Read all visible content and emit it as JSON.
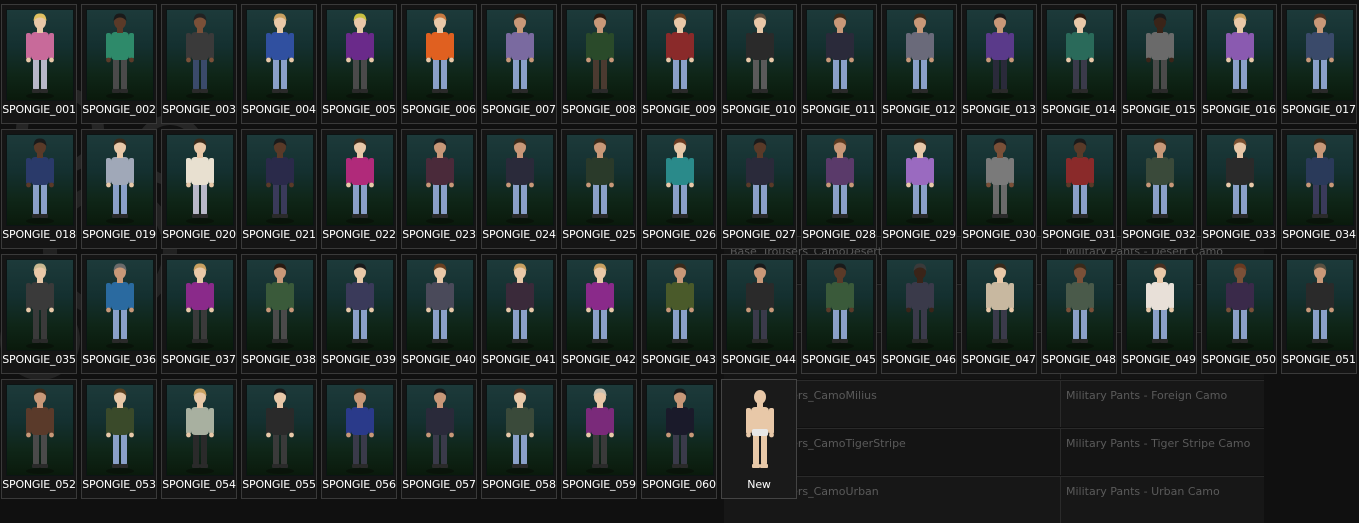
{
  "background_table": {
    "rows": [
      {
        "name": "Base_Trousers_CamoDesert",
        "display": "Military Pants - Desert Camo"
      },
      {
        "name": "",
        "display": ""
      },
      {
        "name": "",
        "display": ""
      },
      {
        "name": "Base_Trousers_CamoMilius",
        "display": "Military Pants - Foreign Camo"
      },
      {
        "name": "Base_Trousers_CamoTigerStripe",
        "display": "Military Pants - Tiger Stripe Camo"
      },
      {
        "name": "Base_Trousers_CamoUrban",
        "display": "Military Pants - Urban Camo"
      }
    ]
  },
  "presets": [
    {
      "label": "SPONGIE_001",
      "top": "#c86a9a",
      "legs": "#b8b8c8",
      "hair": "#e0c060",
      "skin": "#e8c8a8"
    },
    {
      "label": "SPONGIE_002",
      "top": "#2e8a6a",
      "legs": "#4a4a4a",
      "hair": "#1a1a1a",
      "skin": "#5a3a28"
    },
    {
      "label": "SPONGIE_003",
      "top": "#3a3a3a",
      "legs": "#3a4a6a",
      "hair": "#222222",
      "skin": "#7a5038"
    },
    {
      "label": "SPONGIE_004",
      "top": "#3050a0",
      "legs": "#8aa0c8",
      "hair": "#c8a060",
      "skin": "#e8c8a8"
    },
    {
      "label": "SPONGIE_005",
      "top": "#6a2a8a",
      "legs": "#4a4a4a",
      "hair": "#c8c040",
      "skin": "#e8c8a8"
    },
    {
      "label": "SPONGIE_006",
      "top": "#e06020",
      "legs": "#8aa0c8",
      "hair": "#c87a40",
      "skin": "#e8c8a8"
    },
    {
      "label": "SPONGIE_007",
      "top": "#7a6aa0",
      "legs": "#8aa0c8",
      "hair": "#3a2a1a",
      "skin": "#c89878"
    },
    {
      "label": "SPONGIE_008",
      "top": "#2a4a2a",
      "legs": "#4a3a30",
      "hair": "#2a1a10",
      "skin": "#c89878"
    },
    {
      "label": "SPONGIE_009",
      "top": "#8a2a2a",
      "legs": "#8aa0c8",
      "hair": "#6a4020",
      "skin": "#e8c8a8"
    },
    {
      "label": "SPONGIE_010",
      "top": "#2a2a2a",
      "legs": "#5a5a5a",
      "hair": "#5a4a3a",
      "skin": "#e8c8a8"
    },
    {
      "label": "SPONGIE_011",
      "top": "#2a2a3a",
      "legs": "#8aa0c8",
      "hair": "#3a2a1a",
      "skin": "#c89878"
    },
    {
      "label": "SPONGIE_012",
      "top": "#6a6a7a",
      "legs": "#8aa0c8",
      "hair": "#3a2a1a",
      "skin": "#c89878"
    },
    {
      "label": "SPONGIE_013",
      "top": "#5a3a8a",
      "legs": "#2a2a3a",
      "hair": "#1a1a1a",
      "skin": "#c89878"
    },
    {
      "label": "SPONGIE_014",
      "top": "#2a6a5a",
      "legs": "#3a3a4a",
      "hair": "#2a1a10",
      "skin": "#e8c8a8"
    },
    {
      "label": "SPONGIE_015",
      "top": "#6a6a6a",
      "legs": "#4a4a4a",
      "hair": "#1a1a1a",
      "skin": "#3a2418"
    },
    {
      "label": "SPONGIE_016",
      "top": "#8a5ab0",
      "legs": "#8aa0c8",
      "hair": "#c8a060",
      "skin": "#e8c8a8"
    },
    {
      "label": "SPONGIE_017",
      "top": "#3a4a6a",
      "legs": "#8aa0c8",
      "hair": "#4a3020",
      "skin": "#c89878"
    },
    {
      "label": "SPONGIE_018",
      "top": "#2a3a6a",
      "legs": "#8aa0c8",
      "hair": "#1a1a1a",
      "skin": "#5a3a28"
    },
    {
      "label": "SPONGIE_019",
      "top": "#a0a8b8",
      "legs": "#8aa0c8",
      "hair": "#3a2a1a",
      "skin": "#e8c8a8"
    },
    {
      "label": "SPONGIE_020",
      "top": "#e8e0d0",
      "legs": "#b8b8c8",
      "hair": "#3a2a1a",
      "skin": "#e8c8a8"
    },
    {
      "label": "SPONGIE_021",
      "top": "#2a2a4a",
      "legs": "#3a3a5a",
      "hair": "#1a1a1a",
      "skin": "#5a3a28"
    },
    {
      "label": "SPONGIE_022",
      "top": "#b02a7a",
      "legs": "#8aa0c8",
      "hair": "#3a2a1a",
      "skin": "#e8c8a8"
    },
    {
      "label": "SPONGIE_023",
      "top": "#4a2a3a",
      "legs": "#8aa0c8",
      "hair": "#1a1a1a",
      "skin": "#c89878"
    },
    {
      "label": "SPONGIE_024",
      "top": "#2a2a3a",
      "legs": "#8aa0c8",
      "hair": "#3a2a1a",
      "skin": "#c89878"
    },
    {
      "label": "SPONGIE_025",
      "top": "#2a3a2a",
      "legs": "#8aa0c8",
      "hair": "#3a2a1a",
      "skin": "#c89878"
    },
    {
      "label": "SPONGIE_026",
      "top": "#2a8a8a",
      "legs": "#8aa0c8",
      "hair": "#6a3a20",
      "skin": "#e8c8a8"
    },
    {
      "label": "SPONGIE_027",
      "top": "#2a2a3a",
      "legs": "#8aa0c8",
      "hair": "#1a1a1a",
      "skin": "#5a3a28"
    },
    {
      "label": "SPONGIE_028",
      "top": "#5a3a6a",
      "legs": "#8aa0c8",
      "hair": "#5a3a20",
      "skin": "#c89878"
    },
    {
      "label": "SPONGIE_029",
      "top": "#9a6ac0",
      "legs": "#8aa0c8",
      "hair": "#3a2a1a",
      "skin": "#e8c8a8"
    },
    {
      "label": "SPONGIE_030",
      "top": "#7a7a7a",
      "legs": "#6a6a6a",
      "hair": "#1a1a1a",
      "skin": "#7a5038"
    },
    {
      "label": "SPONGIE_031",
      "top": "#8a2a2a",
      "legs": "#8aa0c8",
      "hair": "#1a1a1a",
      "skin": "#5a3a28"
    },
    {
      "label": "SPONGIE_032",
      "top": "#3a4a3a",
      "legs": "#8aa0c8",
      "hair": "#3a2a1a",
      "skin": "#c89878"
    },
    {
      "label": "SPONGIE_033",
      "top": "#2a2a2a",
      "legs": "#8aa0c8",
      "hair": "#7a5030",
      "skin": "#e8c8a8"
    },
    {
      "label": "SPONGIE_034",
      "top": "#2a3a5a",
      "legs": "#3a3a5a",
      "hair": "#3a2a1a",
      "skin": "#c89878"
    },
    {
      "label": "SPONGIE_035",
      "top": "#3a3a3a",
      "legs": "#3a3a3a",
      "hair": "#c8b890",
      "skin": "#e8c8a8"
    },
    {
      "label": "SPONGIE_036",
      "top": "#2a6aa0",
      "legs": "#8aa0c8",
      "hair": "#6a6a6a",
      "skin": "#c89878"
    },
    {
      "label": "SPONGIE_037",
      "top": "#8a2a8a",
      "legs": "#3a3a3a",
      "hair": "#c8a060",
      "skin": "#e8c8a8"
    },
    {
      "label": "SPONGIE_038",
      "top": "#3a5a3a",
      "legs": "#4a4a4a",
      "hair": "#2a1a10",
      "skin": "#c89878"
    },
    {
      "label": "SPONGIE_039",
      "top": "#3a3a5a",
      "legs": "#8aa0c8",
      "hair": "#1a1a1a",
      "skin": "#e8c8a8"
    },
    {
      "label": "SPONGIE_040",
      "top": "#4a4a5a",
      "legs": "#8aa0c8",
      "hair": "#6a4020",
      "skin": "#e8c8a8"
    },
    {
      "label": "SPONGIE_041",
      "top": "#3a2a3a",
      "legs": "#8aa0c8",
      "hair": "#c8a060",
      "skin": "#e8c8a8"
    },
    {
      "label": "SPONGIE_042",
      "top": "#8a2a8a",
      "legs": "#8aa0c8",
      "hair": "#c8a060",
      "skin": "#e8c8a8"
    },
    {
      "label": "SPONGIE_043",
      "top": "#4a5a2a",
      "legs": "#8aa0c8",
      "hair": "#3a2a1a",
      "skin": "#c89878"
    },
    {
      "label": "SPONGIE_044",
      "top": "#2a2a2a",
      "legs": "#3a3a4a",
      "hair": "#1a1a1a",
      "skin": "#c89878"
    },
    {
      "label": "SPONGIE_045",
      "top": "#3a5a3a",
      "legs": "#8aa0c8",
      "hair": "#1a1a1a",
      "skin": "#5a3a28"
    },
    {
      "label": "SPONGIE_046",
      "top": "#3a3a4a",
      "legs": "#3a3a4a",
      "hair": "#3a3a3a",
      "skin": "#3a2418"
    },
    {
      "label": "SPONGIE_047",
      "top": "#c8b8a0",
      "legs": "#3a3a4a",
      "hair": "#3a2a1a",
      "skin": "#e8c8a8"
    },
    {
      "label": "SPONGIE_048",
      "top": "#4a5a4a",
      "legs": "#8aa0c8",
      "hair": "#3a2a1a",
      "skin": "#7a5038"
    },
    {
      "label": "SPONGIE_049",
      "top": "#e8e0d8",
      "legs": "#8aa0c8",
      "hair": "#4a3020",
      "skin": "#e8c8a8"
    },
    {
      "label": "SPONGIE_050",
      "top": "#3a2a4a",
      "legs": "#8aa0c8",
      "hair": "#6a3a20",
      "skin": "#7a5038"
    },
    {
      "label": "SPONGIE_051",
      "top": "#2a2a2a",
      "legs": "#8aa0c8",
      "hair": "#5a5040",
      "skin": "#c89878"
    },
    {
      "label": "SPONGIE_052",
      "top": "#5a3a2a",
      "legs": "#4a4a4a",
      "hair": "#3a2a1a",
      "skin": "#c89878"
    },
    {
      "label": "SPONGIE_053",
      "top": "#3a4a2a",
      "legs": "#8aa0c8",
      "hair": "#5a4020",
      "skin": "#e8c8a8"
    },
    {
      "label": "SPONGIE_054",
      "top": "#a8b0a0",
      "legs": "#2a2a2a",
      "hair": "#c8a060",
      "skin": "#e8c8a8"
    },
    {
      "label": "SPONGIE_055",
      "top": "#2a2a2a",
      "legs": "#3a3a3a",
      "hair": "#1a1a1a",
      "skin": "#e8c8a8"
    },
    {
      "label": "SPONGIE_056",
      "top": "#2a3a8a",
      "legs": "#3a3a4a",
      "hair": "#3a2a1a",
      "skin": "#c89878"
    },
    {
      "label": "SPONGIE_057",
      "top": "#2a2a3a",
      "legs": "#3a3a4a",
      "hair": "#1a1a1a",
      "skin": "#c89878"
    },
    {
      "label": "SPONGIE_058",
      "top": "#3a4a3a",
      "legs": "#8aa0c8",
      "hair": "#4a3020",
      "skin": "#e8c8a8"
    },
    {
      "label": "SPONGIE_059",
      "top": "#7a2a7a",
      "legs": "#3a3a3a",
      "hair": "#c8c0b0",
      "skin": "#e8c8a8"
    },
    {
      "label": "SPONGIE_060",
      "top": "#1a1a2a",
      "legs": "#3a3a4a",
      "hair": "#1a1a1a",
      "skin": "#c89878"
    }
  ],
  "new_preset": {
    "label": "New",
    "skin": "#e8c8a8",
    "underwear": "#e8e8e8"
  }
}
